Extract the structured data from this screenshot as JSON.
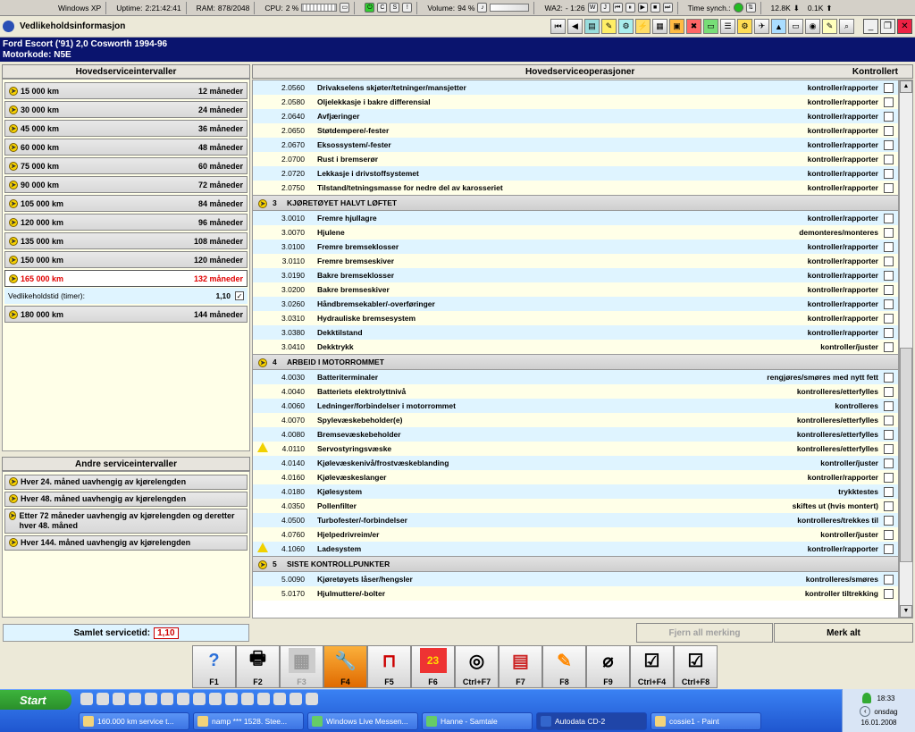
{
  "statusbar": {
    "os": "Windows XP",
    "uptime_label": "Uptime:",
    "uptime": "2:21:42:41",
    "ram_label": "RAM:",
    "ram": "878/2048",
    "cpu_label": "CPU:",
    "cpu": "2 %",
    "volume_label": "Volume:",
    "volume": "94 %",
    "wa_label": "WA2:",
    "wa": "- 1:26",
    "time_sync_label": "Time synch.:",
    "down": "12.8K",
    "up": "0.1K"
  },
  "window": {
    "title": "Vedlikeholdsinformasjon"
  },
  "vehicle": {
    "line1": "Ford  Escort ('91) 2,0 Cosworth 1994-96",
    "line2": "Motorkode: N5E"
  },
  "left": {
    "header": "Hovedserviceintervaller",
    "intervals": [
      {
        "km": "15 000 km",
        "months": "12 måneder"
      },
      {
        "km": "30 000 km",
        "months": "24 måneder"
      },
      {
        "km": "45 000 km",
        "months": "36 måneder"
      },
      {
        "km": "60 000 km",
        "months": "48 måneder"
      },
      {
        "km": "75 000 km",
        "months": "60 måneder"
      },
      {
        "km": "90 000 km",
        "months": "72 måneder"
      },
      {
        "km": "105 000 km",
        "months": "84 måneder"
      },
      {
        "km": "120 000 km",
        "months": "96 måneder"
      },
      {
        "km": "135 000 km",
        "months": "108 måneder"
      },
      {
        "km": "150 000 km",
        "months": "120 måneder"
      },
      {
        "km": "165 000 km",
        "months": "132 måneder"
      }
    ],
    "vedlikeholdstid_label": "Vedlikeholdstid (timer):",
    "vedlikeholdstid_value": "1,10",
    "last_interval": {
      "km": "180 000 km",
      "months": "144 måneder"
    },
    "other_header": "Andre serviceintervaller",
    "other": [
      "Hver 24. måned uavhengig av kjørelengden",
      "Hver 48. måned uavhengig av kjørelengden",
      "Etter 72 måneder uavhengig av kjørelengden og deretter hver 48. måned",
      "Hver 144. måned uavhengig av kjørelengden"
    ]
  },
  "right": {
    "header": "Hovedserviceoperasjoner",
    "checked_header": "Kontrollert",
    "rows_top": [
      {
        "code": "2.0560",
        "name": "Drivakselens skjøter/tetninger/mansjetter",
        "action": "kontroller/rapporter"
      },
      {
        "code": "2.0580",
        "name": "Oljelekkasje i bakre differensial",
        "action": "kontroller/rapporter"
      },
      {
        "code": "2.0640",
        "name": "Avfjæringer",
        "action": "kontroller/rapporter"
      },
      {
        "code": "2.0650",
        "name": "Støtdempere/-fester",
        "action": "kontroller/rapporter"
      },
      {
        "code": "2.0670",
        "name": "Eksossystem/-fester",
        "action": "kontroller/rapporter"
      },
      {
        "code": "2.0700",
        "name": "Rust i bremserør",
        "action": "kontroller/rapporter"
      },
      {
        "code": "2.0720",
        "name": "Lekkasje i drivstoffsystemet",
        "action": "kontroller/rapporter"
      },
      {
        "code": "2.0750",
        "name": "Tilstand/tetningsmasse for nedre del av karosseriet",
        "action": "kontroller/rapporter"
      }
    ],
    "sec3": {
      "num": "3",
      "title": "KJØRETØYET HALVT LØFTET"
    },
    "rows3": [
      {
        "code": "3.0010",
        "name": "Fremre hjullagre",
        "action": "kontroller/rapporter"
      },
      {
        "code": "3.0070",
        "name": "Hjulene",
        "action": "demonteres/monteres"
      },
      {
        "code": "3.0100",
        "name": "Fremre bremseklosser",
        "action": "kontroller/rapporter"
      },
      {
        "code": "3.0110",
        "name": "Fremre bremseskiver",
        "action": "kontroller/rapporter"
      },
      {
        "code": "3.0190",
        "name": "Bakre bremseklosser",
        "action": "kontroller/rapporter"
      },
      {
        "code": "3.0200",
        "name": "Bakre bremseskiver",
        "action": "kontroller/rapporter"
      },
      {
        "code": "3.0260",
        "name": "Håndbremsekabler/-overføringer",
        "action": "kontroller/rapporter"
      },
      {
        "code": "3.0310",
        "name": "Hydrauliske bremsesystem",
        "action": "kontroller/rapporter"
      },
      {
        "code": "3.0380",
        "name": "Dekktilstand",
        "action": "kontroller/rapporter"
      },
      {
        "code": "3.0410",
        "name": "Dekktrykk",
        "action": "kontroller/juster"
      }
    ],
    "sec4": {
      "num": "4",
      "title": "ARBEID I MOTORROMMET"
    },
    "rows4": [
      {
        "code": "4.0030",
        "name": "Batteriterminaler",
        "action": "rengjøres/smøres med nytt fett",
        "warn": ""
      },
      {
        "code": "4.0040",
        "name": "Batteriets elektrolyttnivå",
        "action": "kontrolleres/etterfylles",
        "warn": ""
      },
      {
        "code": "4.0060",
        "name": "Ledninger/forbindelser i motorrommet",
        "action": "kontrolleres",
        "warn": ""
      },
      {
        "code": "4.0070",
        "name": "Spylevæskebeholder(e)",
        "action": "kontrolleres/etterfylles",
        "warn": ""
      },
      {
        "code": "4.0080",
        "name": "Bremsevæskebeholder",
        "action": "kontrolleres/etterfylles",
        "warn": ""
      },
      {
        "code": "4.0110",
        "name": "Servostyringsvæske",
        "action": "kontrolleres/etterfylles",
        "warn": "!"
      },
      {
        "code": "4.0140",
        "name": "Kjølevæskenivå/frostvæskeblanding",
        "action": "kontroller/juster",
        "warn": ""
      },
      {
        "code": "4.0160",
        "name": "Kjølevæskeslanger",
        "action": "kontroller/rapporter",
        "warn": ""
      },
      {
        "code": "4.0180",
        "name": "Kjølesystem",
        "action": "trykktestes",
        "warn": ""
      },
      {
        "code": "4.0350",
        "name": "Pollenfilter",
        "action": "skiftes ut (hvis montert)",
        "warn": ""
      },
      {
        "code": "4.0500",
        "name": "Turbofester/-forbindelser",
        "action": "kontrolleres/trekkes til",
        "warn": ""
      },
      {
        "code": "4.0760",
        "name": "Hjelpedrivreim/er",
        "action": "kontroller/juster",
        "warn": ""
      },
      {
        "code": "4.1060",
        "name": "Ladesystem",
        "action": "kontroller/rapporter",
        "warn": "!"
      }
    ],
    "sec5": {
      "num": "5",
      "title": "SISTE KONTROLLPUNKTER"
    },
    "rows5": [
      {
        "code": "5.0090",
        "name": "Kjøretøyets låser/hengsler",
        "action": "kontrolleres/smøres"
      },
      {
        "code": "5.0170",
        "name": "Hjulmuttere/-bolter",
        "action": "kontroller tiltrekking"
      }
    ]
  },
  "bottom": {
    "samlet_label": "Samlet servicetid:",
    "samlet_value": "1,10",
    "fjern_label": "Fjern all merking",
    "merk_label": "Merk alt"
  },
  "fkeys": [
    "F1",
    "F2",
    "F3",
    "F4",
    "F5",
    "F6",
    "Ctrl+F7",
    "F7",
    "F8",
    "F9",
    "Ctrl+F4",
    "Ctrl+F8"
  ],
  "taskbar": {
    "start": "Start",
    "tasks": [
      "160.000 km service t...",
      "namp *** 1528. Stee...",
      "Windows Live Messen...",
      "Hanne - Samtale",
      "Autodata CD-2",
      "cossie1 - Paint"
    ],
    "time": "18:33",
    "day": "onsdag",
    "date": "16.01.2008"
  },
  "colors": {
    "navy": "#0a146e",
    "active_red": "#e00000",
    "row_yellow": "#ffffe8",
    "row_blue": "#dff4ff"
  }
}
